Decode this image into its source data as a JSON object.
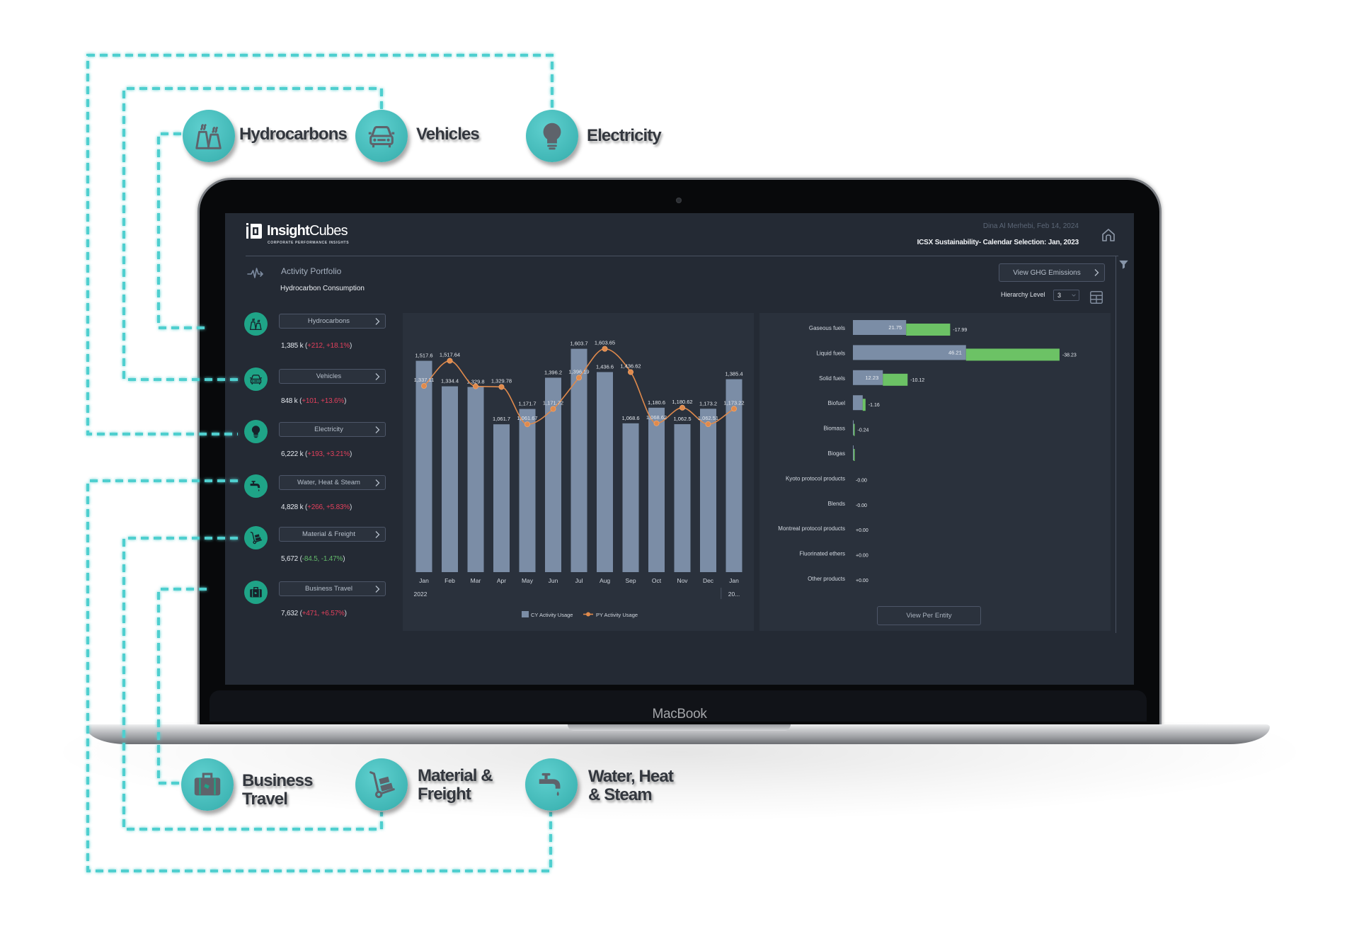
{
  "annotations": {
    "top": [
      {
        "label": "Hydrocarbons",
        "icon": "cooling-towers-icon"
      },
      {
        "label": "Vehicles",
        "icon": "car-icon"
      },
      {
        "label": "Electricity",
        "icon": "light-bulb-icon"
      }
    ],
    "bottom": [
      {
        "line1": "Business",
        "line2": "Travel",
        "icon": "suitcase-icon"
      },
      {
        "line1": "Material &",
        "line2": "Freight",
        "icon": "hand-truck-icon"
      },
      {
        "line1": "Water, Heat",
        "line2": "& Steam",
        "icon": "faucet-icon"
      }
    ],
    "connector_color": "#4fcfcf"
  },
  "device": {
    "brand_label": "MacBook"
  },
  "app": {
    "logo_bold": "Insight",
    "logo_light": "Cubes",
    "logo_tagline": "CORPORATE PERFORMANCE INSIGHTS",
    "user_line": "Dina Al Merhebi, Feb 14, 2024",
    "context_title": "ICSX Sustainability- Calendar Selection:  Jan, 2023",
    "section_title": "Activity Portfolio",
    "section_subtitle": "Hydrocarbon Consumption",
    "view_ghg_button": "View GHG Emissions",
    "hierarchy_label": "Hierarchy Level",
    "hierarchy_value": "3",
    "view_per_entity_button": "View Per Entity"
  },
  "sidebar": {
    "items": [
      {
        "label": "Hydrocarbons",
        "icon": "cooling-towers-icon",
        "value": "1,385 k",
        "delta": "+212, +18.1%",
        "trend": "up"
      },
      {
        "label": "Vehicles",
        "icon": "car-icon",
        "value": "848 k",
        "delta": "+101, +13.6%",
        "trend": "up"
      },
      {
        "label": "Electricity",
        "icon": "light-bulb-icon",
        "value": "6,222 k",
        "delta": "+193, +3.21%",
        "trend": "up"
      },
      {
        "label": "Water, Heat & Steam",
        "icon": "faucet-icon",
        "value": "4,828 k",
        "delta": "+266, +5.83%",
        "trend": "up"
      },
      {
        "label": "Material & Freight",
        "icon": "hand-truck-icon",
        "value": "5,672",
        "delta": "-84.5, -1.47%",
        "trend": "down"
      },
      {
        "label": "Business Travel",
        "icon": "suitcase-icon",
        "value": "7,632",
        "delta": "+471, +6.57%",
        "trend": "up"
      }
    ]
  },
  "colors": {
    "accent_teal": "#1fa487",
    "increase_red": "#e2405c",
    "decrease_green": "#63b96a",
    "bar_slate": "#7b8da6",
    "line_orange": "#e08a4c",
    "change_green": "#6cc265"
  },
  "chart_data": [
    {
      "type": "bar",
      "title": "Hydrocarbon Consumption",
      "xlabel": "",
      "ylabel": "",
      "categories": [
        "Jan",
        "Feb",
        "Mar",
        "Apr",
        "May",
        "Jun",
        "Jul",
        "Aug",
        "Sep",
        "Oct",
        "Nov",
        "Dec",
        "Jan"
      ],
      "category_groups": [
        {
          "label": "2022",
          "start_index": 0
        },
        {
          "label": "20...",
          "start_index": 12
        }
      ],
      "ylim": [
        0,
        1800
      ],
      "grid": false,
      "legend": "bottom-center",
      "series": [
        {
          "name": "CY Activity Usage",
          "type": "bar",
          "color": "#7b8da6",
          "values": [
            1517.6,
            1334.4,
            1329.8,
            1061.7,
            1171.7,
            1396.2,
            1603.7,
            1436.6,
            1068.6,
            1180.6,
            1062.5,
            1173.2,
            1385.4
          ],
          "labels": [
            "1,517.6",
            "1,334.4",
            "1,329.8",
            "1,061.7",
            "1,171.7",
            "1,396.2",
            "1,603.7",
            "1,436.6",
            "1,068.6",
            "1,180.6",
            "1,062.5",
            "1,173.2",
            "1,385.4"
          ]
        },
        {
          "name": "PY Activity Usage",
          "type": "line",
          "color": "#e08a4c",
          "values": [
            1337.11,
            1517.64,
            1334.4,
            1329.78,
            1061.67,
            1171.72,
            1396.19,
            1603.65,
            1436.62,
            1068.62,
            1180.62,
            1062.51,
            1173.22
          ],
          "labels": [
            "1,337.11",
            "1,517.64",
            null,
            "1,329.78",
            "1,061.67",
            "1,171.72",
            "1,396.19",
            "1,603.65",
            "1,436.62",
            "1,068.62",
            "1,180.62",
            "1,062.51",
            "1,173.22"
          ]
        }
      ]
    },
    {
      "type": "bar",
      "orientation": "horizontal",
      "title": "",
      "categories": [
        "Gaseous fuels",
        "Liquid fuels",
        "Solid fuels",
        "Biofuel",
        "Biomass",
        "Biogas",
        "Kyoto protocol products",
        "Blends",
        "Montreal protocol products",
        "Fluorinated ethers",
        "Other products"
      ],
      "xlim": [
        0,
        105
      ],
      "grid": false,
      "legend": "none",
      "series": [
        {
          "name": "value",
          "color": "#7b8da6",
          "values": [
            21.75,
            46.21,
            12.23,
            4.0,
            0.1,
            0.1,
            0,
            0,
            0,
            0,
            0
          ],
          "labels": [
            "21.75",
            "46.21",
            "12.23",
            "",
            "",
            "",
            "",
            "",
            "",
            "",
            ""
          ]
        },
        {
          "name": "change",
          "color": "#6cc265",
          "values": [
            -17.99,
            -38.23,
            -10.12,
            -1.16,
            -0.24,
            -0.1,
            0,
            0,
            0,
            0,
            0
          ],
          "labels": [
            "-17.99",
            "-38.23",
            "-10.12",
            "-1.16",
            "-0.24",
            "",
            "-0.00",
            "-0.00",
            "+0.00",
            "+0.00",
            "+0.00"
          ]
        }
      ]
    }
  ]
}
